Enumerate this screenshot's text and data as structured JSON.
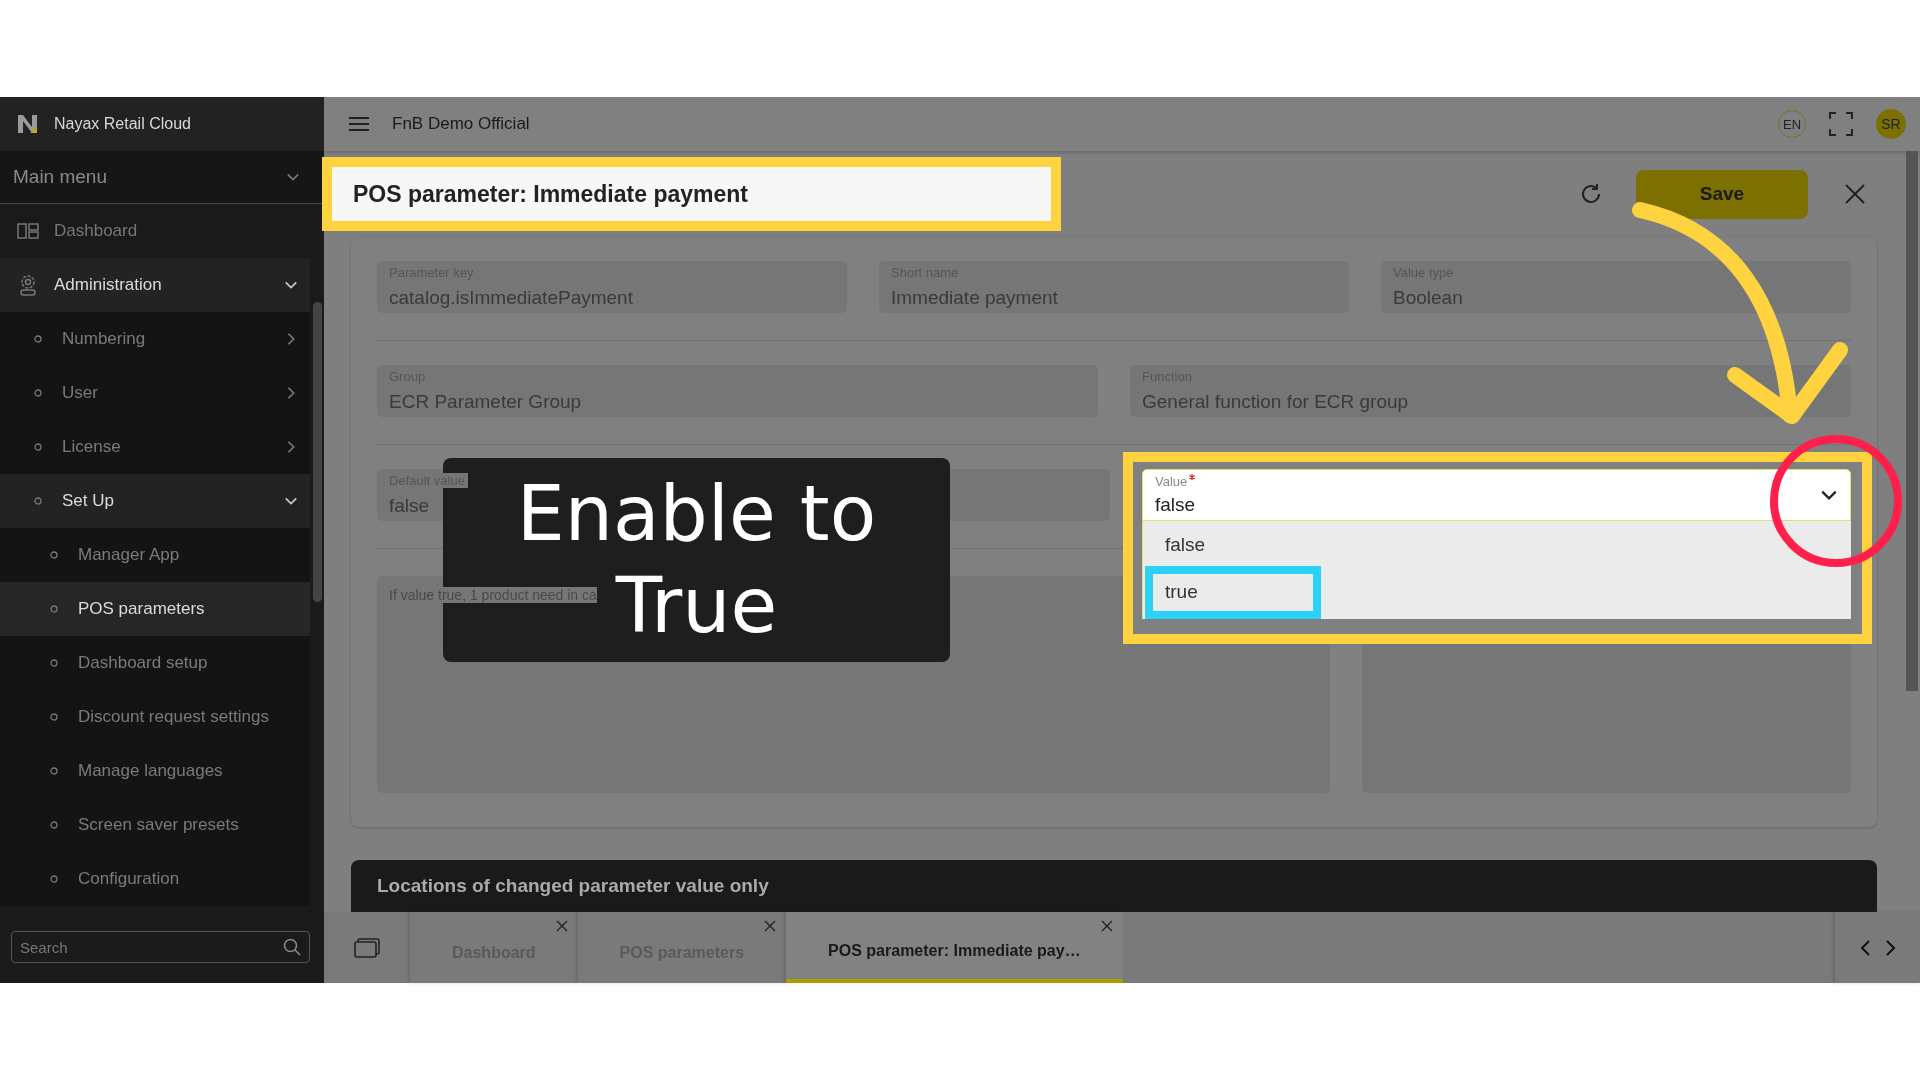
{
  "sidebar": {
    "brand": "Nayax Retail Cloud",
    "menu_title": "Main menu",
    "items": [
      {
        "kind": "link",
        "label": "Dashboard",
        "selected": false
      },
      {
        "kind": "group",
        "label": "Administration",
        "expanded": true,
        "children": [
          {
            "kind": "group",
            "label": "Numbering",
            "expanded": false
          },
          {
            "kind": "group",
            "label": "User",
            "expanded": false
          },
          {
            "kind": "group",
            "label": "License",
            "expanded": false
          },
          {
            "kind": "group",
            "label": "Set Up",
            "expanded": true,
            "children": [
              {
                "kind": "link",
                "label": "Manager App",
                "selected": false
              },
              {
                "kind": "link",
                "label": "POS parameters",
                "selected": true
              },
              {
                "kind": "link",
                "label": "Dashboard setup",
                "selected": false
              },
              {
                "kind": "link",
                "label": "Discount request settings",
                "selected": false
              },
              {
                "kind": "link",
                "label": "Manage languages",
                "selected": false
              },
              {
                "kind": "link",
                "label": "Screen saver presets",
                "selected": false
              },
              {
                "kind": "link",
                "label": "Configuration",
                "selected": false
              }
            ]
          }
        ]
      }
    ],
    "search": {
      "placeholder": "Search"
    }
  },
  "topbar": {
    "workspace": "FnB Demo Official",
    "language": "EN",
    "avatar": "SR"
  },
  "header": {
    "title": "POS parameter: Immediate payment",
    "save": "Save"
  },
  "form": {
    "rows": [
      [
        {
          "label": "Parameter key",
          "value": "catalog.isImmediatePayment"
        },
        {
          "label": "Short name",
          "value": "Immediate payment"
        },
        {
          "label": "Value type",
          "value": "Boolean"
        }
      ],
      [
        {
          "label": "Group",
          "value": "ECR Parameter Group"
        },
        {
          "label": "Function",
          "value": "General function for ECR group"
        }
      ]
    ],
    "default_value": {
      "label": "Default value",
      "value": "false"
    },
    "value": {
      "label": "Value",
      "required": true,
      "value": "false",
      "expanded": true,
      "options": [
        {
          "label": "false",
          "highlighted": false
        },
        {
          "label": "true",
          "highlighted": true
        }
      ]
    },
    "description": "If value true, 1 product need in ca"
  },
  "section": {
    "title": "Locations of changed parameter value only"
  },
  "tabs": [
    {
      "label": "Dashboard",
      "selected": false
    },
    {
      "label": "POS parameters",
      "selected": false
    },
    {
      "label": "POS parameter: Immediate pay…",
      "selected": true
    }
  ],
  "annotations": {
    "caption": "Enable to True"
  }
}
